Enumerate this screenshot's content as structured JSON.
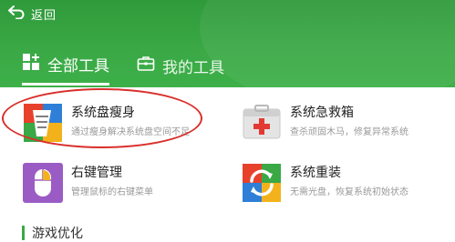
{
  "header": {
    "back_label": "返回",
    "tabs": [
      {
        "label": "全部工具",
        "active": true,
        "icon": "grid-plus-icon"
      },
      {
        "label": "我的工具",
        "active": false,
        "icon": "toolbox-icon"
      }
    ]
  },
  "tools": [
    {
      "name": "系统盘瘦身",
      "desc": "通过瘦身解决系统盘空间不足",
      "icon": "disk-slim-icon"
    },
    {
      "name": "系统急救箱",
      "desc": "查杀顽固木马，修复异常系统",
      "icon": "first-aid-kit-icon"
    },
    {
      "name": "右键管理",
      "desc": "管理鼠标的右键菜单",
      "icon": "mouse-icon"
    },
    {
      "name": "系统重装",
      "desc": "无需光盘，恢复系统初始状态",
      "icon": "reinstall-icon"
    }
  ],
  "section": {
    "title": "游戏优化"
  },
  "colors": {
    "header_green": "#3aa845",
    "annotation_red": "#d9302c"
  }
}
